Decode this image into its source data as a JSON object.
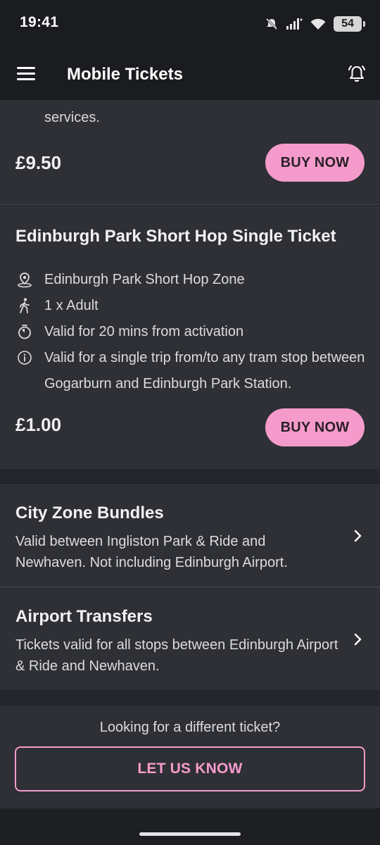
{
  "status_bar": {
    "time": "19:41",
    "battery": "54"
  },
  "app_bar": {
    "title": "Mobile Tickets"
  },
  "partial_card": {
    "text": "services.",
    "price": "£9.50",
    "buy_label": "BUY NOW"
  },
  "ticket": {
    "title": "Edinburgh Park Short Hop Single Ticket",
    "features": [
      {
        "icon": "location-pin-icon",
        "text": "Edinburgh Park Short Hop Zone"
      },
      {
        "icon": "walking-person-icon",
        "text": "1 x Adult"
      },
      {
        "icon": "stopwatch-icon",
        "text": "Valid for 20 mins from activation"
      },
      {
        "icon": "info-icon",
        "text": "Valid for a single trip from/to any tram stop between Gogarburn and Edinburgh Park Station."
      }
    ],
    "price": "£1.00",
    "buy_label": "BUY NOW"
  },
  "categories": [
    {
      "title": "City Zone Bundles",
      "description": "Valid between Ingliston Park & Ride and Newhaven. Not including Edinburgh Airport."
    },
    {
      "title": "Airport Transfers",
      "description": "Tickets valid for all stops between Edinburgh Airport  & Ride and Newhaven."
    }
  ],
  "feedback": {
    "question": "Looking for a different ticket?",
    "button_label": "LET US KNOW"
  },
  "colors": {
    "accent": "#f59bcb",
    "card": "#2e3036",
    "background": "#1e1f23"
  }
}
